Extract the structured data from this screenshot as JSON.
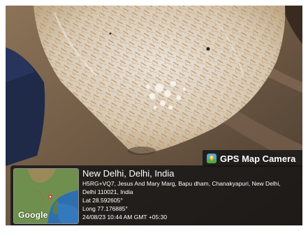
{
  "badge": {
    "title": "GPS Map Camera",
    "icon": "gps-map-camera-app-icon"
  },
  "location": {
    "place": "New Delhi, Delhi, India",
    "address": "H5RG+VQ7, Jesus And Mary Marg, Bapu dham, Chanakyapuri, New Delhi, Delhi 110021, India",
    "lat": "Lat 28.592605°",
    "long": "Long 77.176885°",
    "datetime": "24/08/23 10:44 AM GMT +05:30"
  },
  "map": {
    "provider": "Google"
  },
  "colors": {
    "overlay": "#141414",
    "text": "#ffffff",
    "map_land": "#6f8f4e",
    "map_water": "#2f6fb0"
  }
}
